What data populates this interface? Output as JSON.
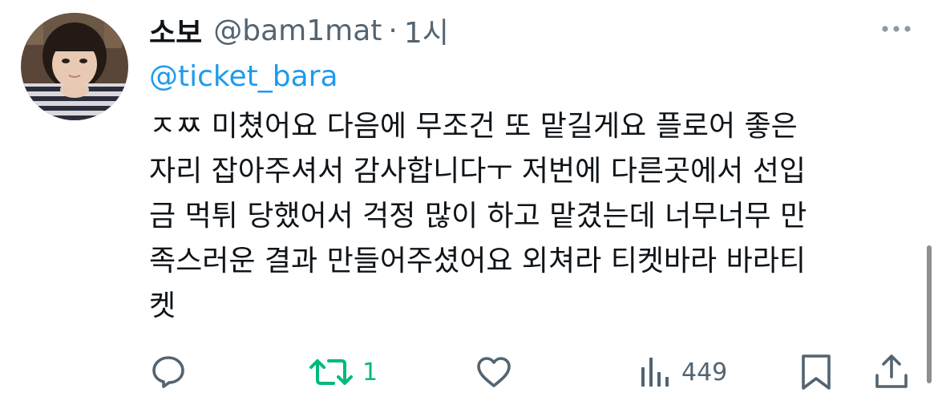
{
  "tweet": {
    "author": {
      "display_name": "소보",
      "handle": "@bam1mat",
      "separator": "·",
      "time": "1시"
    },
    "mention": "@ticket_bara",
    "text_lines": [
      "ㅈㅉ 미쳤어요 다음에 무조건 또 맡길게요 플로어 좋은",
      "자리 잡아주셔서 감사합니다ㅜ 저번에 다른곳에서 선입",
      "금 먹튀 당했어서 걱정 많이 하고 맡겼는데 너무너무 만",
      "족스러운 결과 만들어주셨어요 외쳐라 티켓바라 바라티",
      "켓"
    ],
    "actions": {
      "reply": {
        "icon": "reply-icon"
      },
      "retweet": {
        "icon": "retweet-icon",
        "count": "1",
        "color": "#00ba7c"
      },
      "like": {
        "icon": "heart-icon"
      },
      "views": {
        "icon": "views-icon",
        "count": "449"
      },
      "bookmark": {
        "icon": "bookmark-icon"
      },
      "share": {
        "icon": "share-icon"
      }
    }
  },
  "colors": {
    "text": "#0f1419",
    "muted": "#536471",
    "link": "#1d9bf0",
    "retweet_active": "#00ba7c"
  }
}
